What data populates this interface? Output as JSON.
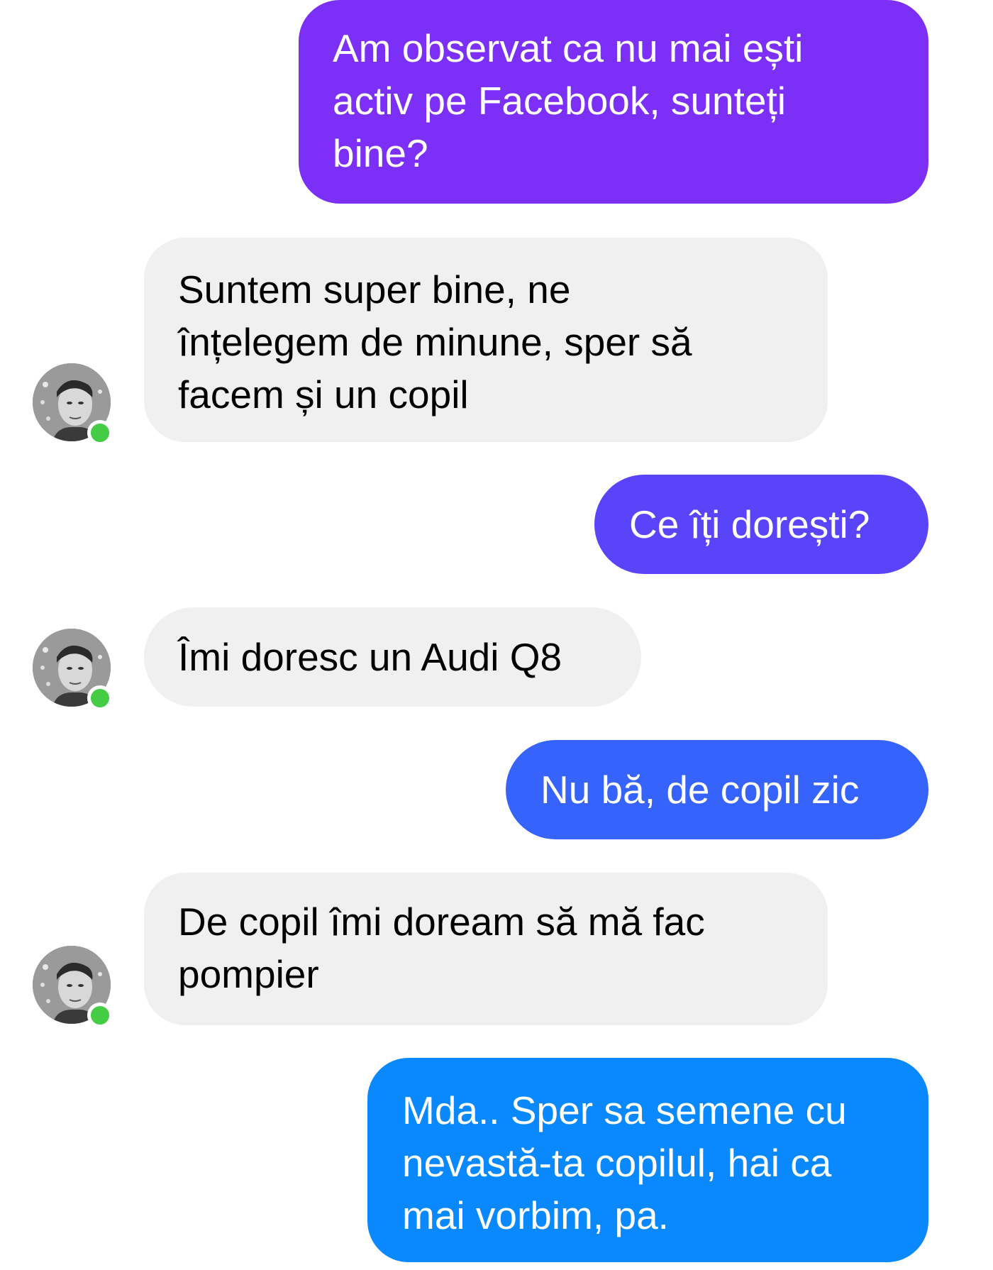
{
  "colors": {
    "received_bg": "#f0f0f0",
    "sent_gradient": [
      "#7b2ff7",
      "#6a38f9",
      "#5a44fa",
      "#4a52fb",
      "#3663fc",
      "#1f76fd",
      "#0a88fe"
    ],
    "online_dot": "#44cc44"
  },
  "messages": [
    {
      "direction": "sent",
      "text": "Am observat ca nu mai ești\nactiv pe Facebook, sunteți\nbine?"
    },
    {
      "direction": "received",
      "text": "Suntem super bine, ne\nînțelegem de minune, sper să\nfacem și un copil",
      "avatar": "contact-avatar"
    },
    {
      "direction": "sent",
      "text": "Ce îți dorești?"
    },
    {
      "direction": "received",
      "text": "Îmi doresc un Audi Q8",
      "avatar": "contact-avatar"
    },
    {
      "direction": "sent",
      "text": "Nu bă, de copil zic"
    },
    {
      "direction": "received",
      "text": "De copil îmi doream să mă fac\npompier",
      "avatar": "contact-avatar"
    },
    {
      "direction": "sent",
      "text": "Mda.. Sper sa semene cu\nnevastă-ta copilul, hai ca\nmai vorbim, pa."
    }
  ]
}
